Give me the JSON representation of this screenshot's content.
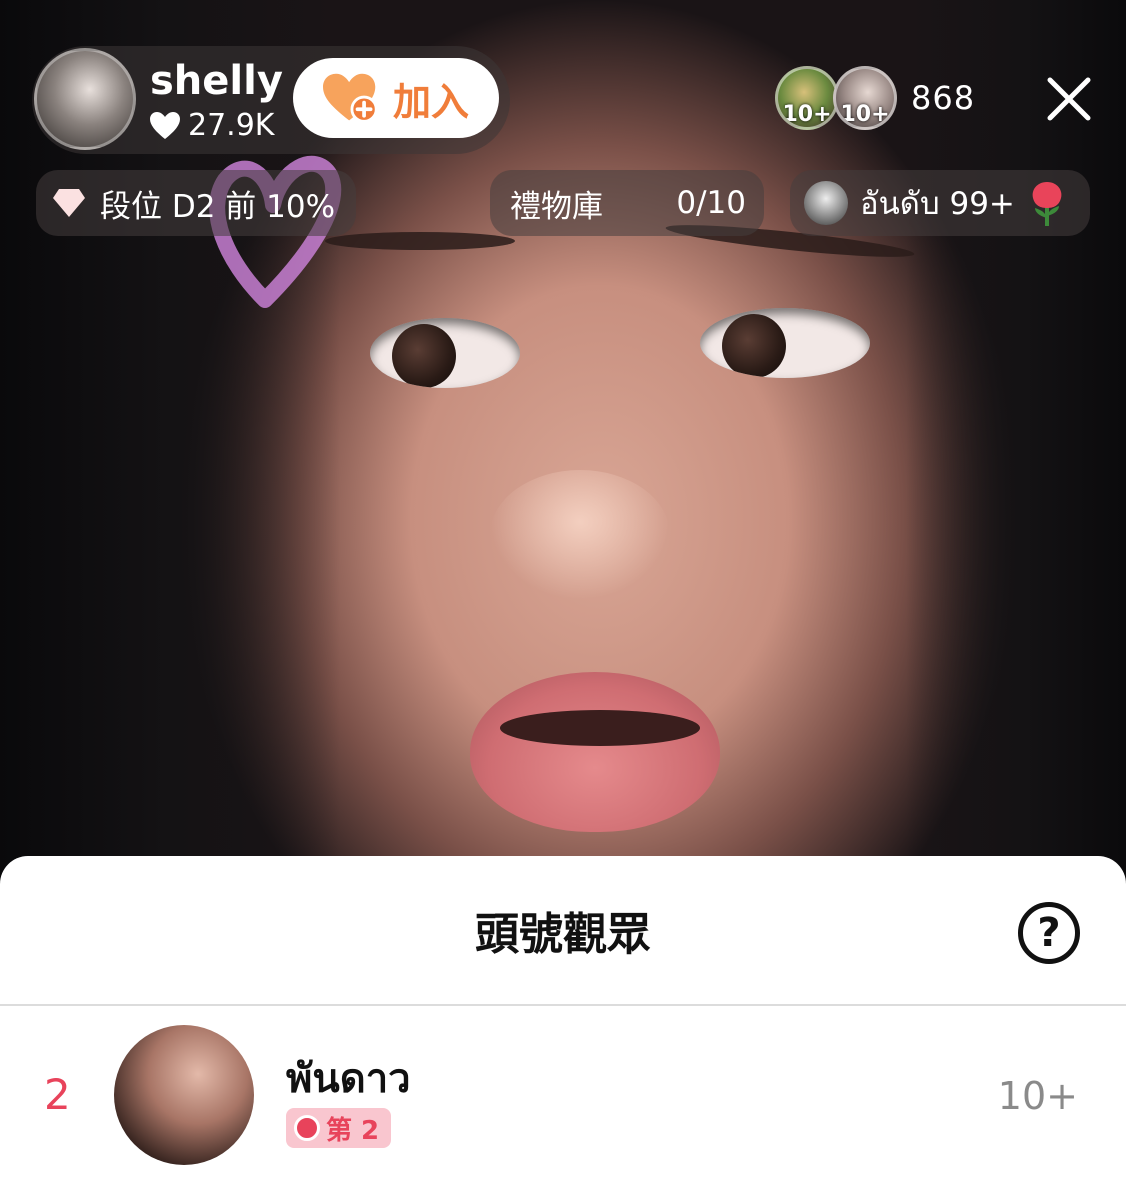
{
  "creator": {
    "name": "shelly",
    "likes": "27.9K",
    "join_label": "加入"
  },
  "viewers": {
    "badges": [
      "10+",
      "10+"
    ],
    "count": "868"
  },
  "chips": {
    "rank": "段位 D2 前 10%",
    "gift_label": "禮物庫",
    "gift_count": "0/10",
    "thai_rank": "อันดับ 99+"
  },
  "sheet": {
    "title": "頭號觀眾",
    "help": "?",
    "rows": [
      {
        "rank": "2",
        "name": "พันดาว",
        "badge": "第 2",
        "score": "10+"
      }
    ]
  },
  "colors": {
    "accent_orange": "#f07d3a",
    "rank_red": "#e8435b",
    "badge_pink": "#f9c6cf"
  }
}
